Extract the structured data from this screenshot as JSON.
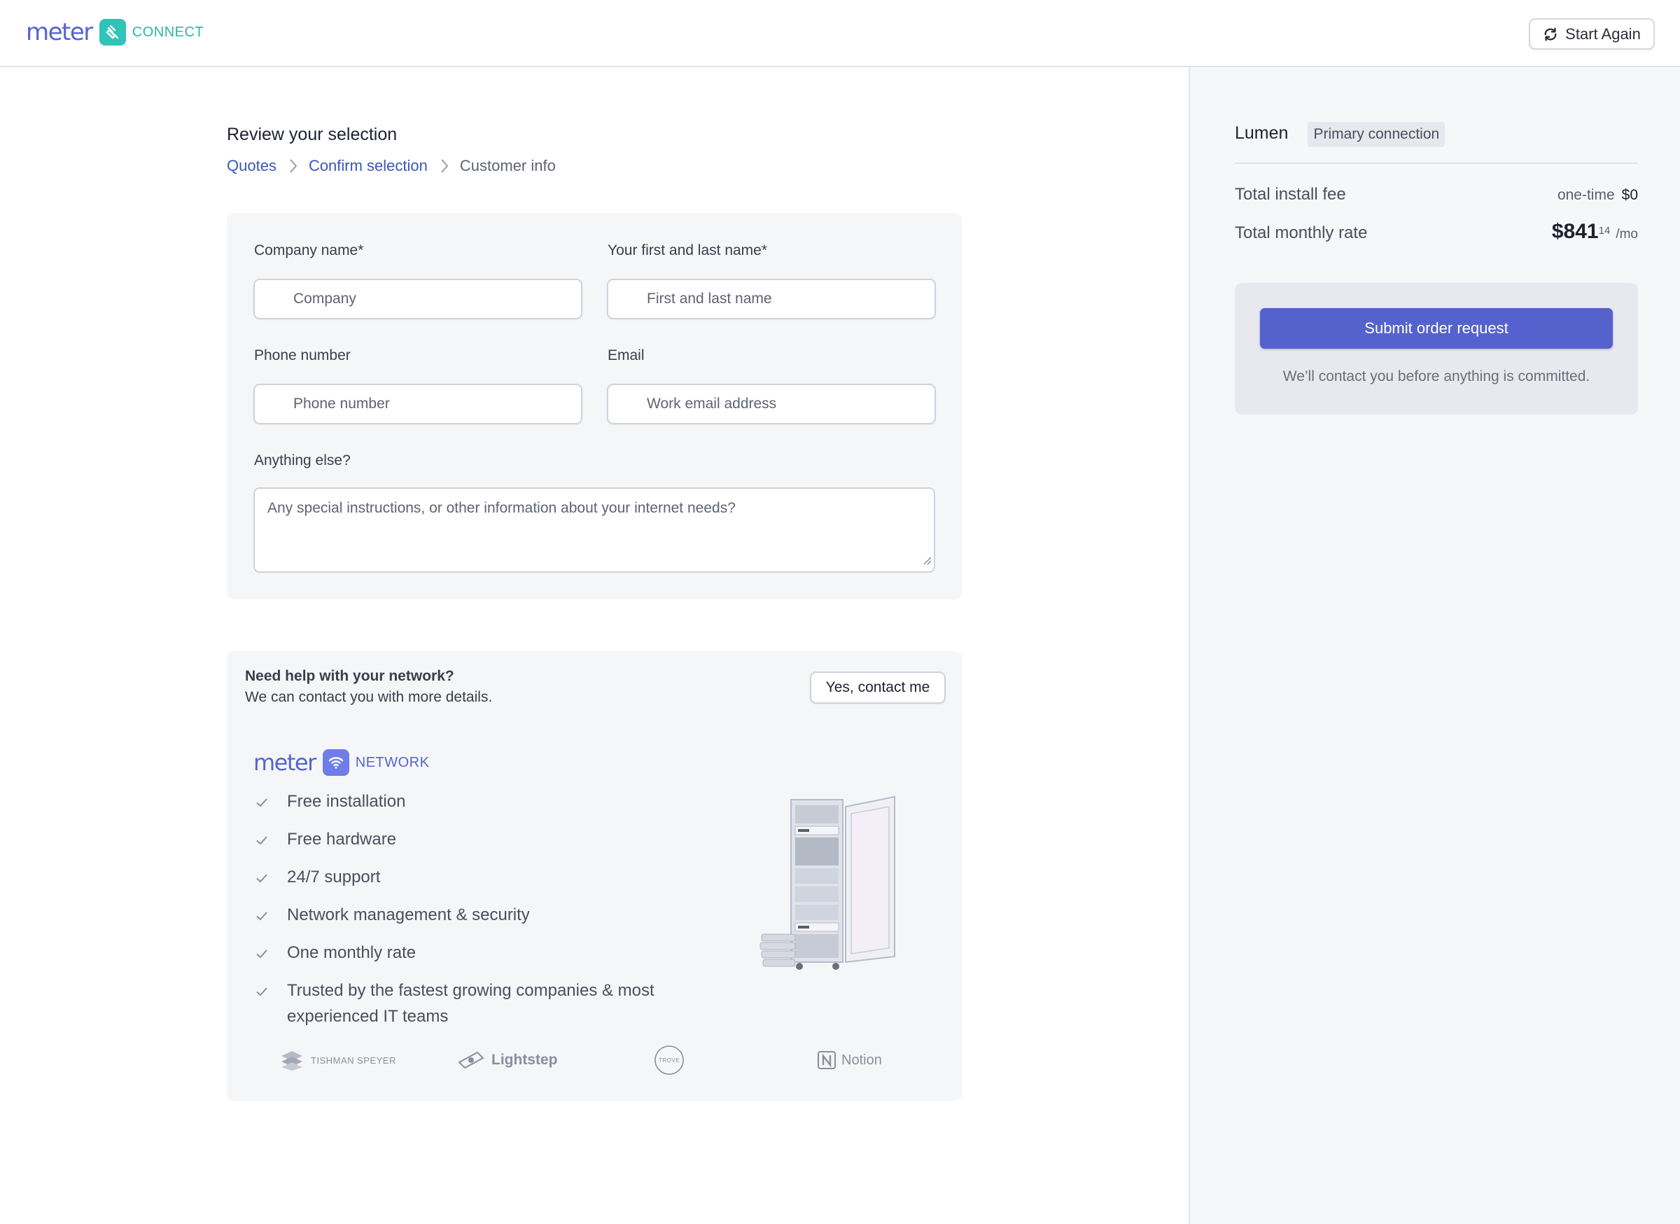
{
  "header": {
    "logo_word": "meter",
    "logo_product": "CONNECT",
    "start_again_label": "Start Again"
  },
  "main": {
    "title": "Review your selection",
    "breadcrumb": [
      {
        "label": "Quotes"
      },
      {
        "label": "Confirm selection"
      },
      {
        "label": "Customer info"
      }
    ]
  },
  "form": {
    "company": {
      "label": "Company name*",
      "placeholder": "Company",
      "value": ""
    },
    "name": {
      "label": "Your first and last name*",
      "placeholder": "First and last name",
      "value": ""
    },
    "phone": {
      "label": "Phone number",
      "placeholder": "Phone number",
      "value": ""
    },
    "email": {
      "label": "Email",
      "placeholder": "Work email address",
      "value": ""
    },
    "notes": {
      "label": "Anything else?",
      "placeholder": "Any special instructions, or other information about your internet needs?",
      "value": ""
    }
  },
  "help": {
    "title": "Need help with your network?",
    "subtitle": "We can contact you with more details.",
    "contact_label": "Yes, contact me",
    "logo_word": "meter",
    "logo_product": "NETWORK",
    "features": [
      "Free installation",
      "Free hardware",
      "24/7 support",
      "Network management & security",
      "One monthly rate",
      "Trusted by the fastest growing companies & most experienced IT teams"
    ],
    "partners": [
      "TISHMAN SPEYER",
      "Lightstep",
      "TROVE",
      "Notion"
    ]
  },
  "sidebar": {
    "carrier": "Lumen",
    "connection_type": "Primary connection",
    "install_fee_label": "Total install fee",
    "install_fee_qualifier": "one-time",
    "install_fee_value": "$0",
    "monthly_label": "Total monthly rate",
    "monthly_dollars": "$841",
    "monthly_cents": "14",
    "monthly_unit": "/mo",
    "submit_label": "Submit order request",
    "submit_note": "We’ll contact you before anything is committed."
  },
  "colors": {
    "accent": "#5561cc",
    "brand_meter": "#5564cf",
    "brand_connect": "#2ec4b6",
    "link": "#3b57b8",
    "sidebar_bg": "#f6f7f9",
    "card_bg": "#f5f6f8"
  },
  "icons": {
    "start_again": "refresh-icon",
    "breadcrumb_separator": "chevron-right-icon",
    "feature_bullet": "check-icon",
    "connect_logo": "plug-icon",
    "network_logo": "wifi-icon"
  }
}
